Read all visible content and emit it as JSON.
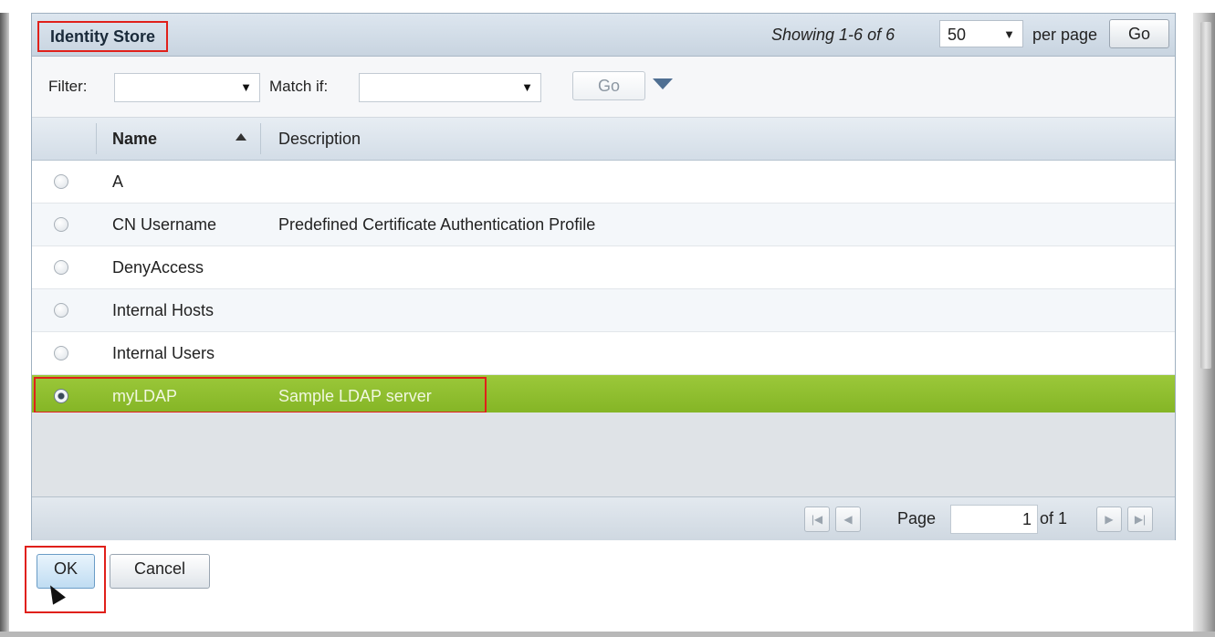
{
  "panel": {
    "title": "Identity Store",
    "showing": "Showing 1-6 of 6",
    "per_page_value": "50",
    "per_page_label": "per page",
    "go_label": "Go"
  },
  "filter": {
    "filter_label": "Filter:",
    "match_label": "Match if:",
    "go_label": "Go"
  },
  "table": {
    "columns": [
      "Name",
      "Description"
    ],
    "rows": [
      {
        "name": "A",
        "description": "",
        "selected": false
      },
      {
        "name": "CN Username",
        "description": "Predefined Certificate Authentication Profile",
        "selected": false
      },
      {
        "name": "DenyAccess",
        "description": "",
        "selected": false
      },
      {
        "name": "Internal Hosts",
        "description": "",
        "selected": false
      },
      {
        "name": "Internal Users",
        "description": "",
        "selected": false
      },
      {
        "name": "myLDAP",
        "description": "Sample LDAP server",
        "selected": true
      }
    ]
  },
  "pager": {
    "page_label": "Page",
    "page_value": "1",
    "of_label": "of 1"
  },
  "actions": {
    "ok_label": "OK",
    "cancel_label": "Cancel"
  },
  "colors": {
    "selected_row": "#8dbc2b",
    "highlight_box": "#e0201a",
    "header": "#d3dde7"
  }
}
